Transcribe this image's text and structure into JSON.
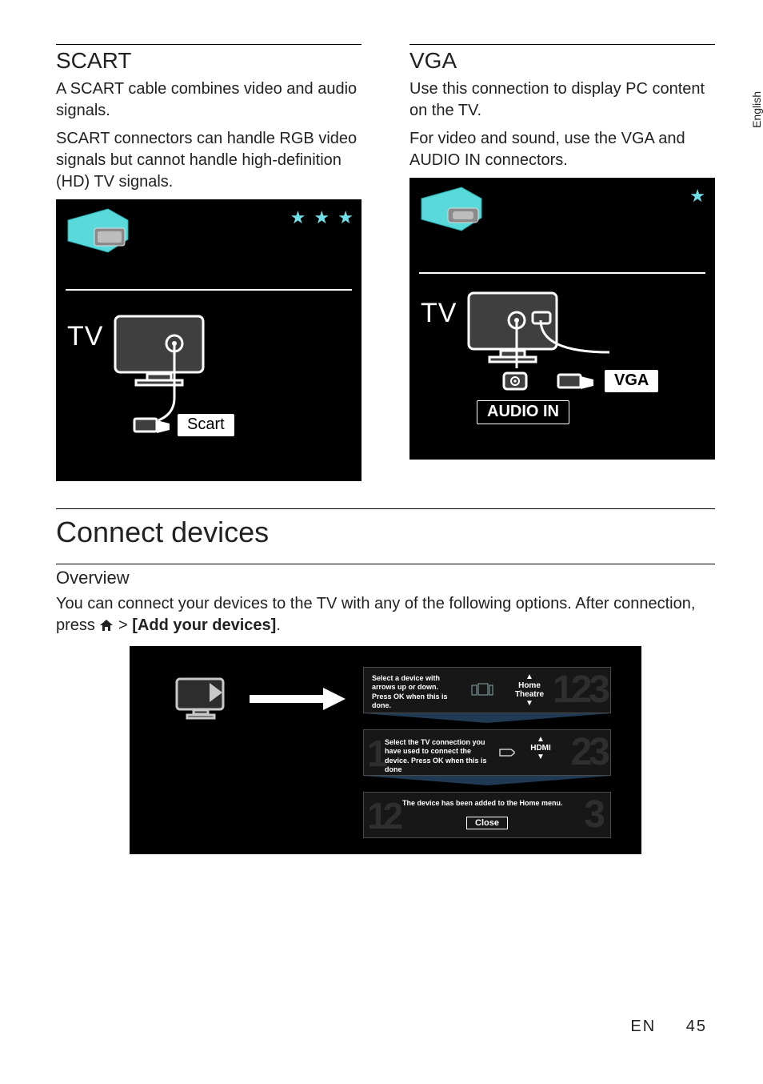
{
  "sideTab": "English",
  "scart": {
    "heading": "SCART",
    "p1": "A SCART cable combines video and audio signals.",
    "p2": "SCART connectors can handle RGB video signals but cannot handle high-definition (HD) TV signals.",
    "figure": {
      "tv": "TV",
      "scartLabel": "Scart",
      "stars": "★ ★ ★"
    }
  },
  "vga": {
    "heading": "VGA",
    "p1": "Use this connection to display PC content on the TV.",
    "p2": "For video and sound, use the VGA and AUDIO IN connectors.",
    "figure": {
      "tv": "TV",
      "vgaLabel": "VGA",
      "audioIn": "AUDIO IN",
      "stars": "★"
    }
  },
  "connect": {
    "heading": "Connect devices",
    "overviewHeading": "Overview",
    "overviewP1a": "You can connect your devices to the TV with any of the following options. After connection, press ",
    "overviewP1b": " > ",
    "overviewP1c": "[Add your devices]",
    "overviewP1d": "."
  },
  "onscreen": {
    "step1": "Select a device with arrows up or down.\nPress OK when this is done.",
    "step1Choice": "Home Theatre",
    "step2": "Select the TV connection you have used to connect the device. Press OK when this is done",
    "step2Choice": "HDMI",
    "step3": "The device has been added to the Home menu.",
    "closeBtn": "Close",
    "big1": "123",
    "big2": "23",
    "big3": "3",
    "ghost1": "1",
    "ghost12": "12"
  },
  "footer": {
    "lang": "EN",
    "page": "45"
  }
}
